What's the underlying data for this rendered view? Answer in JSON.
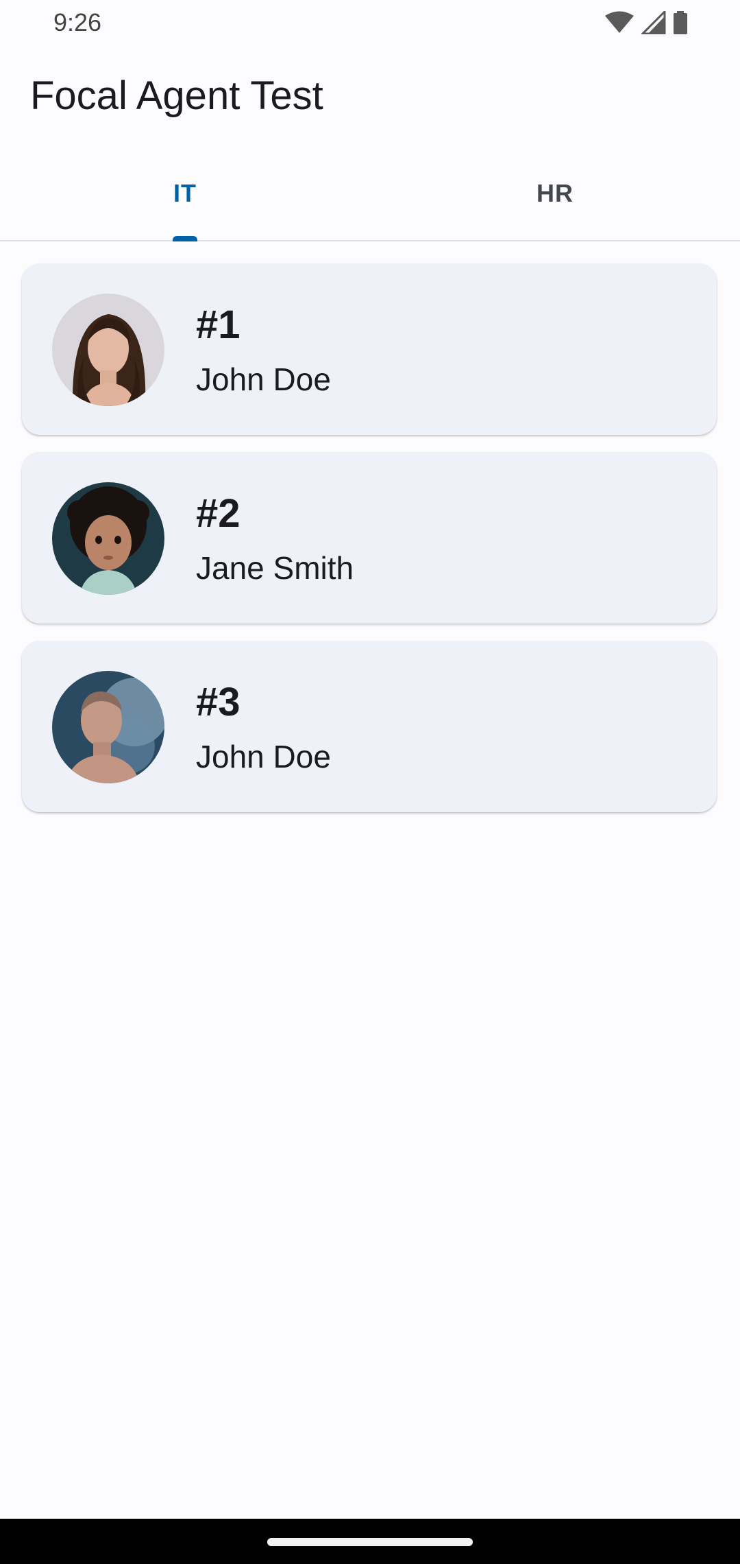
{
  "status_bar": {
    "time": "9:26",
    "icons": [
      "wifi-icon",
      "cell-signal-icon",
      "battery-icon"
    ]
  },
  "app_bar": {
    "title": "Focal Agent Test"
  },
  "tabs": [
    {
      "label": "IT",
      "selected": true
    },
    {
      "label": "HR",
      "selected": false
    }
  ],
  "employees": [
    {
      "number": "#1",
      "name": "John Doe",
      "avatar": "woman-portrait-avatar"
    },
    {
      "number": "#2",
      "name": "Jane Smith",
      "avatar": "child-portrait-avatar"
    },
    {
      "number": "#3",
      "name": "John Doe",
      "avatar": "man-portrait-avatar"
    }
  ],
  "colors": {
    "accent": "#0061a4",
    "card_background": "#eff1f8",
    "page_background": "#fcfbfe",
    "text": "#1b1b1f"
  }
}
